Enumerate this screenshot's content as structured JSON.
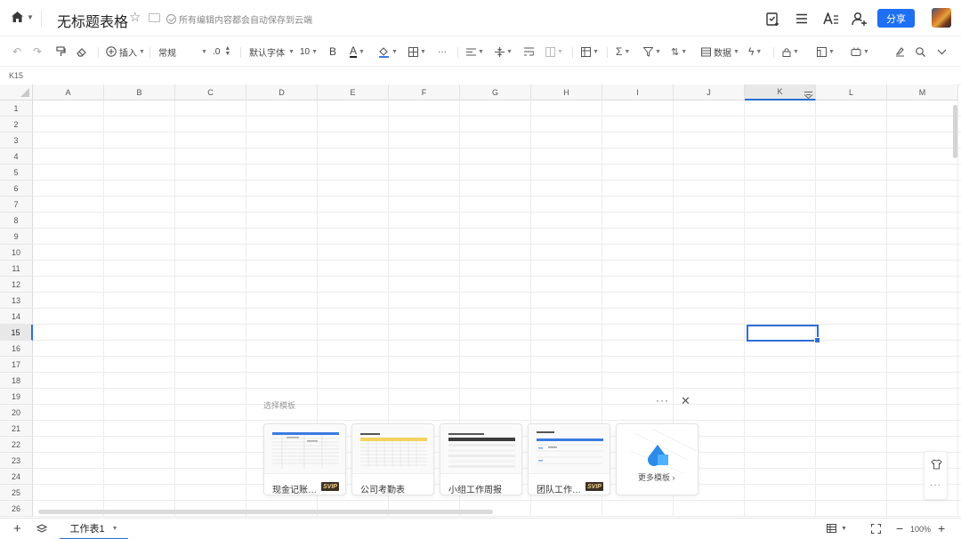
{
  "header": {
    "title": "无标题表格",
    "save_status": "所有编辑内容都会自动保存到云端",
    "share_label": "分享"
  },
  "toolbar": {
    "insert": "插入",
    "number_format": "常规",
    "decimal": ".0",
    "font_family": "默认字体",
    "font_size": "10",
    "bold": "B",
    "font_color": "A",
    "more": "···",
    "data": "数据"
  },
  "namebox": "K15",
  "columns": [
    "A",
    "B",
    "C",
    "D",
    "E",
    "F",
    "G",
    "H",
    "I",
    "J",
    "K",
    "L",
    "M"
  ],
  "rows": [
    "1",
    "2",
    "3",
    "4",
    "5",
    "6",
    "7",
    "8",
    "9",
    "10",
    "11",
    "12",
    "13",
    "14",
    "15",
    "16",
    "17",
    "18",
    "19",
    "20",
    "21",
    "22",
    "23",
    "24",
    "25",
    "26"
  ],
  "selected_cell": {
    "column": "K",
    "row": "15"
  },
  "templates": {
    "label": "选择模板",
    "items": [
      {
        "name": "现金记账…",
        "badge": "SVIP"
      },
      {
        "name": "公司考勤表",
        "badge": ""
      },
      {
        "name": "小组工作周报",
        "badge": ""
      },
      {
        "name": "团队工作…",
        "badge": "SVIP"
      }
    ],
    "more": "更多模板 ›"
  },
  "bottom": {
    "sheet_name": "工作表1",
    "zoom": "100%"
  },
  "colors": {
    "accent": "#1f6ff2",
    "selection": "#2b6fd6"
  }
}
